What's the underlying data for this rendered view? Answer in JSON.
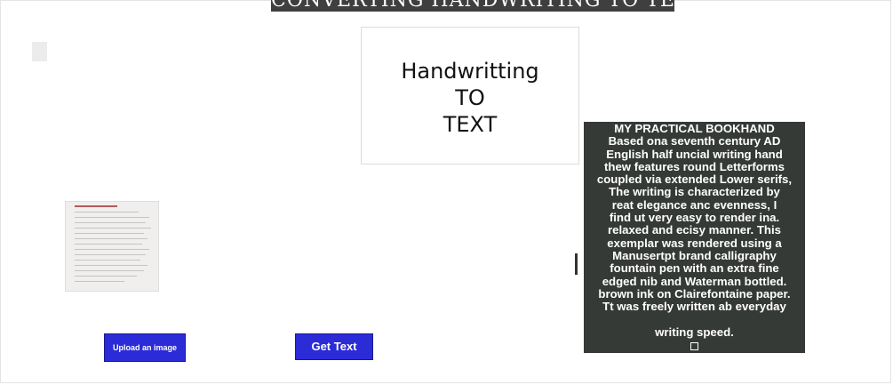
{
  "header": {
    "title": "CONVERTING HANDWRITING TO TEXT"
  },
  "hero": {
    "lines": [
      "Handwritting",
      "TO",
      "TEXT"
    ]
  },
  "buttons": {
    "upload_label": "Upload an image",
    "get_text_label": "Get Text"
  },
  "result": {
    "lines": [
      "MY PRACTICAL BOOKHAND",
      "Based ona seventh century AD",
      "English half uncial writing hand",
      "thew features round Letterforms",
      "coupled via extended Lower serifs,",
      "The writing is characterized by",
      "reat elegance anc evenness, I",
      "find ut very easy to render ina.",
      "relaxed and ecisy manner. This",
      "exemplar was rendered using a",
      "Manusertpt brand calligraphy",
      "fountain pen with an extra fine",
      "edged nib and Waterman bottled.",
      "brown ink on Clairefontaine paper.",
      "Tt was freely written ab everyday",
      "",
      "writing speed."
    ]
  },
  "colors": {
    "button_bg": "#2b2bd8",
    "panel_bg": "#363a37",
    "title_bg": "#3f3f3f"
  }
}
